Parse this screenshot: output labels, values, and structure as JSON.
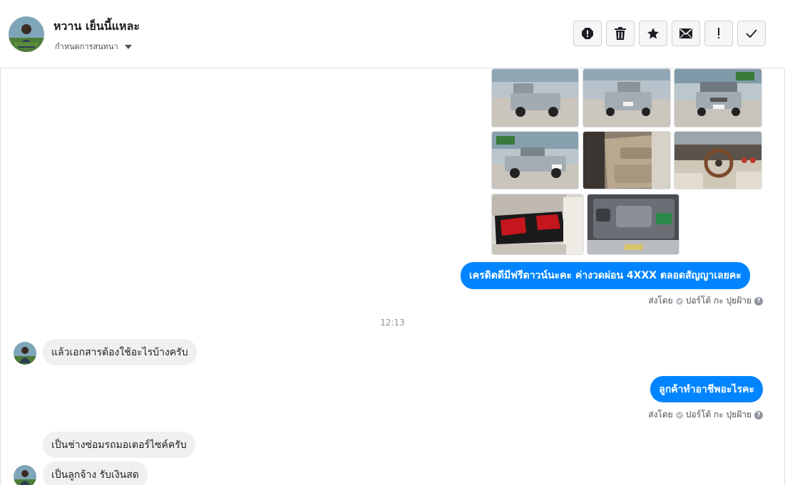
{
  "header": {
    "contact_name": "หวาน เย็นนี้แหละ",
    "assign_label": "กำหนดการสนทนา",
    "toolbar": [
      {
        "name": "report-spam-button",
        "icon": "alert-circle-icon"
      },
      {
        "name": "delete-button",
        "icon": "trash-icon"
      },
      {
        "name": "star-button",
        "icon": "star-icon"
      },
      {
        "name": "mark-unread-button",
        "icon": "envelope-icon"
      },
      {
        "name": "follow-up-button",
        "icon": "exclamation-icon"
      },
      {
        "name": "mark-done-button",
        "icon": "checkmark-icon"
      }
    ]
  },
  "thread": {
    "photos": [
      {
        "name": "photo-truck-rear-left",
        "icon": "truck-photo"
      },
      {
        "name": "photo-truck-rear",
        "icon": "truck-photo"
      },
      {
        "name": "photo-truck-front",
        "icon": "truck-photo"
      },
      {
        "name": "photo-truck-side-front",
        "icon": "truck-photo"
      },
      {
        "name": "photo-door-interior",
        "icon": "door-photo"
      },
      {
        "name": "photo-dashboard",
        "icon": "dashboard-photo"
      },
      {
        "name": "photo-seats",
        "icon": "seat-photo"
      },
      {
        "name": "photo-engine",
        "icon": "engine-photo"
      }
    ],
    "messages": [
      {
        "text": "เครดิตดีมีฟรีดาวน์นะคะ ค่างวดผ่อน 4XXX  ตลอดสัญญาเลยคะ",
        "sent_by_label": "ส่งโดย",
        "sent_by_name": "ปอร์โต้ กะ ปุยฝ้าย"
      },
      {
        "timestamp": "12:13"
      },
      {
        "text": "แล้วเอกสารต้องใช้อะไรบ้างครับ"
      },
      {
        "text": "ลูกค้าทำอาชีพอะไรคะ",
        "sent_by_label": "ส่งโดย",
        "sent_by_name": "ปอร์โต้ กะ ปุยฝ้าย"
      },
      {
        "text": "เป็นช่างซ่อมรถมอเตอร์ไซค์ครับ"
      },
      {
        "text": "เป็นลูกจ้าง รับเงินสด"
      }
    ]
  },
  "colors": {
    "outgoing_bubble": "#0084ff",
    "incoming_bubble": "#f1f0f0",
    "border": "#dddfe2"
  }
}
